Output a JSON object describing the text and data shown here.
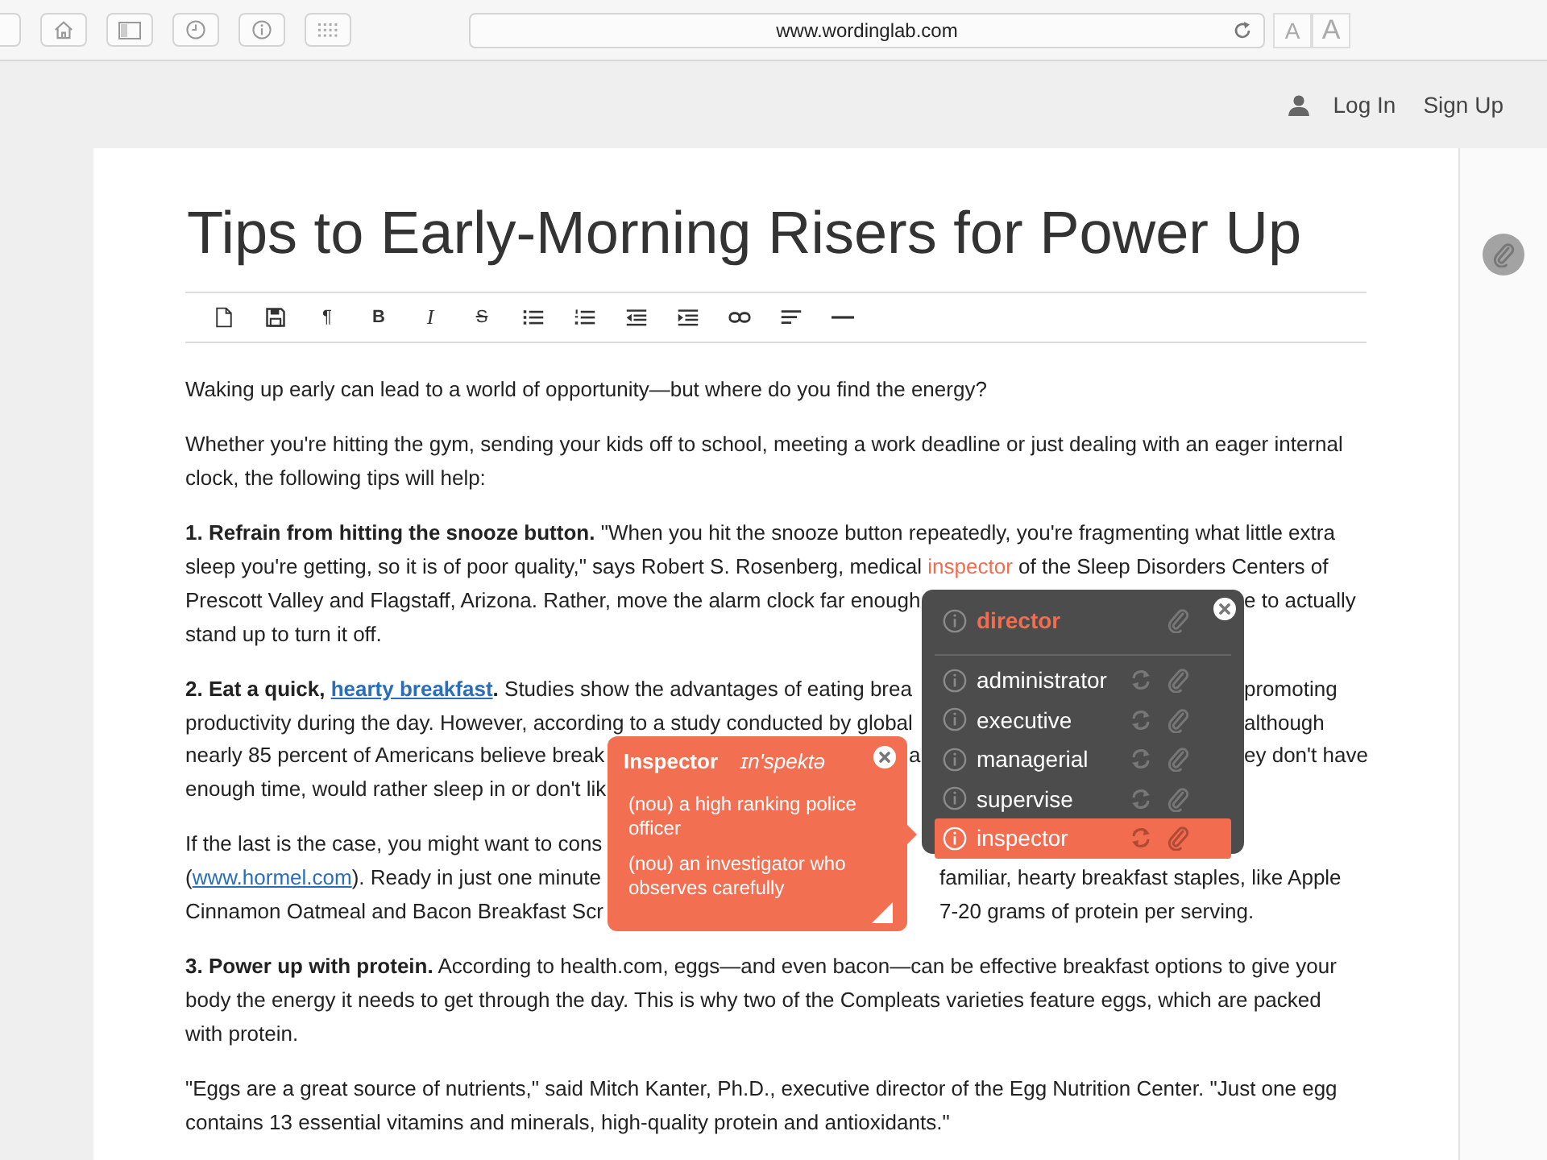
{
  "browser": {
    "url": "www.wordinglab.com",
    "font_buttons": [
      "A",
      "A"
    ]
  },
  "header": {
    "login": "Log In",
    "signup": "Sign Up"
  },
  "article": {
    "title": "Tips to Early-Morning Risers for Power Up",
    "toolbar": [
      {
        "kind": "icon"
      },
      {
        "kind": "icon"
      },
      {
        "kind": "glyph",
        "label": "¶"
      },
      {
        "kind": "bold_glyph",
        "label": "B"
      },
      {
        "kind": "italic_glyph",
        "label": "I"
      },
      {
        "kind": "strike_glyph",
        "label": "S"
      },
      {
        "kind": "icon"
      },
      {
        "kind": "icon"
      },
      {
        "kind": "icon"
      },
      {
        "kind": "icon"
      },
      {
        "kind": "icon"
      },
      {
        "kind": "icon"
      },
      {
        "kind": "icon"
      }
    ],
    "paragraphs": [
      {
        "lines": [
          {
            "kind": "full",
            "segments": [
              [
                {
                  "kind": "plain",
                  "text": "Waking up early can lead to a world of opportunity—but where do you find the energy?"
                }
              ]
            ]
          }
        ]
      },
      {
        "lines": [
          {
            "kind": "full",
            "segments": [
              [
                {
                  "kind": "plain",
                  "text": "Whether you're hitting the gym, sending your kids off to school, meeting a work deadline or just dealing with an eager internal"
                }
              ]
            ]
          },
          {
            "kind": "full",
            "segments": [
              [
                {
                  "kind": "plain",
                  "text": "clock, the following tips will help:"
                }
              ]
            ]
          }
        ]
      },
      {
        "lines": [
          {
            "kind": "full",
            "segments": [
              [
                {
                  "kind": "bold",
                  "text": "1. Refrain from hitting the snooze button."
                },
                {
                  "kind": "plain",
                  "text": " \"When you hit the snooze button repeatedly, you're fragmenting what little extra"
                }
              ]
            ]
          },
          {
            "kind": "full",
            "segments": [
              [
                {
                  "kind": "plain",
                  "text": "sleep you're getting, so it is of poor quality,\" says Robert S. Rosenberg, medical "
                },
                {
                  "kind": "highlight",
                  "text": "inspector"
                },
                {
                  "kind": "plain",
                  "text": " of the Sleep Disorders Centers of"
                }
              ]
            ]
          },
          {
            "kind": "director",
            "segments": [
              [
                {
                  "kind": "plain",
                  "text": "Prescott Valley and Flagstaff, Arizona. Rather, move the alarm clock far enough"
                }
              ],
              [
                {
                  "kind": "plain",
                  "text": "e to actually"
                }
              ]
            ]
          },
          {
            "kind": "full",
            "segments": [
              [
                {
                  "kind": "plain",
                  "text": "stand up to turn it off."
                }
              ]
            ]
          }
        ]
      },
      {
        "lines": [
          {
            "kind": "director",
            "segments": [
              [
                {
                  "kind": "bold",
                  "text": "2. Eat a quick, "
                },
                {
                  "kind": "bold_link",
                  "text": "hearty breakfast"
                },
                {
                  "kind": "bold",
                  "text": "."
                },
                {
                  "kind": "plain",
                  "text": " Studies show the advantages of eating brea"
                }
              ],
              [
                {
                  "kind": "plain",
                  "text": "promoting"
                }
              ]
            ]
          },
          {
            "kind": "director",
            "segments": [
              [
                {
                  "kind": "plain",
                  "text": "productivity during the day. However, according to a study conducted by global"
                }
              ],
              [
                {
                  "kind": "plain",
                  "text": "although"
                }
              ]
            ]
          },
          {
            "kind": "both",
            "segments": [
              [
                {
                  "kind": "plain",
                  "text": "nearly 85 percent of Americans believe break"
                }
              ],
              [
                {
                  "kind": "plain",
                  "text": "a"
                }
              ],
              [
                {
                  "kind": "plain",
                  "text": "ey don't have"
                }
              ]
            ]
          },
          {
            "kind": "full",
            "segments": [
              [
                {
                  "kind": "plain",
                  "text": "enough time, would rather sleep in or don't lik"
                }
              ]
            ]
          }
        ]
      },
      {
        "lines": [
          {
            "kind": "full",
            "segments": [
              [
                {
                  "kind": "plain",
                  "text": "If the last is the case, you might want to cons"
                }
              ]
            ]
          },
          {
            "kind": "inspector",
            "segments": [
              [
                {
                  "kind": "plain",
                  "text": "("
                },
                {
                  "kind": "link",
                  "text": "www.hormel.com"
                },
                {
                  "kind": "plain",
                  "text": "). Ready in just one minute"
                }
              ],
              [
                {
                  "kind": "plain",
                  "text": "familiar, hearty breakfast staples, like Apple"
                }
              ]
            ]
          },
          {
            "kind": "inspector",
            "segments": [
              [
                {
                  "kind": "plain",
                  "text": "Cinnamon Oatmeal and Bacon Breakfast Scr"
                }
              ],
              [
                {
                  "kind": "plain",
                  "text": "7-20 grams of protein per serving."
                }
              ]
            ]
          }
        ]
      },
      {
        "lines": [
          {
            "kind": "full",
            "segments": [
              [
                {
                  "kind": "bold",
                  "text": "3. Power up with protein."
                },
                {
                  "kind": "plain",
                  "text": " According to health.com, eggs—and even bacon—can be effective breakfast options to give your"
                }
              ]
            ]
          },
          {
            "kind": "full",
            "segments": [
              [
                {
                  "kind": "plain",
                  "text": "body the energy it needs to get through the day. This is why two of the Compleats varieties feature eggs, which are packed"
                }
              ]
            ]
          },
          {
            "kind": "full",
            "segments": [
              [
                {
                  "kind": "plain",
                  "text": "with protein."
                }
              ]
            ]
          }
        ]
      },
      {
        "lines": [
          {
            "kind": "full",
            "segments": [
              [
                {
                  "kind": "plain",
                  "text": "\"Eggs are a great source of nutrients,\" said Mitch Kanter, Ph.D., executive director of the Egg Nutrition Center. \"Just one egg"
                }
              ]
            ]
          },
          {
            "kind": "full",
            "segments": [
              [
                {
                  "kind": "plain",
                  "text": "contains 13 essential vitamins and minerals, high-quality protein and antioxidants.\""
                }
              ]
            ]
          }
        ]
      }
    ]
  },
  "synonym_popup": {
    "word": "director",
    "items": [
      {
        "word": "administrator",
        "selected": false
      },
      {
        "word": "executive",
        "selected": false
      },
      {
        "word": "managerial",
        "selected": false
      },
      {
        "word": "supervise",
        "selected": false
      },
      {
        "word": "inspector",
        "selected": true
      }
    ]
  },
  "definition_popup": {
    "word": "Inspector",
    "pronunciation": "ɪn'spektə",
    "definitions": [
      "(nou) a high ranking police officer",
      "(nou) an investigator who observes carefully"
    ]
  }
}
